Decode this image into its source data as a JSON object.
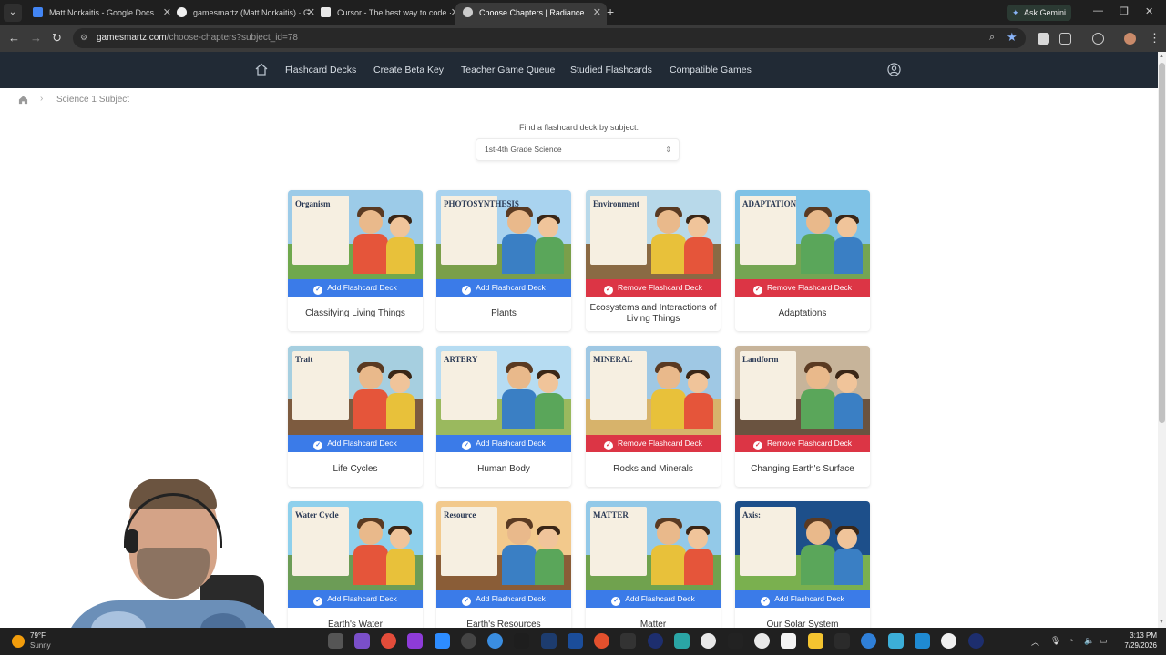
{
  "browser": {
    "tabs": [
      {
        "title": "Matt Norkaitis - Google Docs",
        "color": "#4285f4"
      },
      {
        "title": "gamesmartz (Matt Norkaitis) · G",
        "color": "#f0f0f0"
      },
      {
        "title": "Cursor - The best way to code ·",
        "color": "#e8e8e8"
      },
      {
        "title": "Choose Chapters | Radiance",
        "color": "#cccccc"
      }
    ],
    "gemini_label": "Ask Gemini",
    "url_domain": "gamesmartz.com",
    "url_path": "/choose-chapters?subject_id=78"
  },
  "nav": {
    "links": [
      "Flashcard Decks",
      "Create Beta Key",
      "Teacher Game Queue",
      "Studied Flashcards",
      "Compatible Games"
    ]
  },
  "breadcrumb": {
    "current": "Science 1 Subject"
  },
  "subject_finder": {
    "label": "Find a flashcard deck by subject:",
    "selected": "1st-4th Grade Science"
  },
  "cards": [
    {
      "title": "Classifying Living Things",
      "button": "Add Flashcard Deck",
      "state": "add",
      "poster": "Organism",
      "sky": "#9ccbe8",
      "ground": "#6fa84d"
    },
    {
      "title": "Plants",
      "button": "Add Flashcard Deck",
      "state": "add",
      "poster": "PHOTOSYNTHESIS",
      "sky": "#a9d3ef",
      "ground": "#7a9f4a"
    },
    {
      "title": "Ecosystems and Interactions of Living Things",
      "button": "Remove Flashcard Deck",
      "state": "remove",
      "poster": "Environment",
      "sky": "#b8d9ea",
      "ground": "#8a6a44"
    },
    {
      "title": "Adaptations",
      "button": "Remove Flashcard Deck",
      "state": "remove",
      "poster": "ADAPTATION",
      "sky": "#7fc2e6",
      "ground": "#74a553"
    },
    {
      "title": "Life Cycles",
      "button": "Add Flashcard Deck",
      "state": "add",
      "poster": "Trait",
      "sky": "#a6cfe0",
      "ground": "#7d5b3f"
    },
    {
      "title": "Human Body",
      "button": "Add Flashcard Deck",
      "state": "add",
      "poster": "ARTERY",
      "sky": "#b6dcf2",
      "ground": "#9ab95e"
    },
    {
      "title": "Rocks and Minerals",
      "button": "Remove Flashcard Deck",
      "state": "remove",
      "poster": "MINERAL",
      "sky": "#9fc8e4",
      "ground": "#d7b36b"
    },
    {
      "title": "Changing Earth's Surface",
      "button": "Remove Flashcard Deck",
      "state": "remove",
      "poster": "Landform",
      "sky": "#c7b49a",
      "ground": "#6a5340"
    },
    {
      "title": "Earth's Water",
      "button": "Add Flashcard Deck",
      "state": "add",
      "poster": "Water Cycle",
      "sky": "#8ed0ec",
      "ground": "#6c9c56"
    },
    {
      "title": "Earth's Resources",
      "button": "Add Flashcard Deck",
      "state": "add",
      "poster": "Resource",
      "sky": "#f2c98c",
      "ground": "#8a5d37"
    },
    {
      "title": "Matter",
      "button": "Add Flashcard Deck",
      "state": "add",
      "poster": "MATTER",
      "sky": "#93c9e8",
      "ground": "#70a24e"
    },
    {
      "title": "Our Solar System",
      "button": "Add Flashcard Deck",
      "state": "add",
      "poster": "Axis:",
      "sky": "#1d4f8a",
      "ground": "#7ab04f"
    }
  ],
  "colors": {
    "add_button": "#3b7be8",
    "remove_button": "#dc3545",
    "nav_bg": "#212a35"
  },
  "taskbar": {
    "temperature": "79°F",
    "condition": "Sunny",
    "time": "3:13 PM",
    "date": "7/29/2026"
  }
}
